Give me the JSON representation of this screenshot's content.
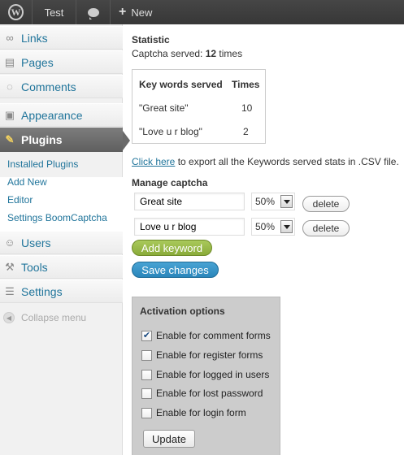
{
  "adminbar": {
    "logo_icon": "wordpress-logo-icon",
    "site_label": "Test",
    "comments_icon": "comment-bubble-icon",
    "new_label": "New"
  },
  "sidebar": {
    "items": [
      {
        "label": "Links",
        "icon": "link-icon"
      },
      {
        "label": "Pages",
        "icon": "pages-icon"
      },
      {
        "label": "Comments",
        "icon": "comments-icon"
      },
      {
        "label": "Appearance",
        "icon": "appearance-icon"
      },
      {
        "label": "Plugins",
        "icon": "plugin-icon"
      },
      {
        "label": "Users",
        "icon": "users-icon"
      },
      {
        "label": "Tools",
        "icon": "tools-icon"
      },
      {
        "label": "Settings",
        "icon": "settings-icon"
      }
    ],
    "submenu": [
      "Installed Plugins",
      "Add New",
      "Editor",
      "Settings BoomCaptcha"
    ],
    "collapse_label": "Collapse menu"
  },
  "main": {
    "statistic_heading": "Statistic",
    "served_prefix": "Captcha served: ",
    "served_count": "12",
    "served_suffix": " times",
    "table": {
      "headers": [
        "Key words served",
        "Times"
      ],
      "rows": [
        {
          "keyword": "\"Great site\"",
          "times": "10"
        },
        {
          "keyword": "\"Love u r blog\"",
          "times": "2"
        }
      ]
    },
    "export_link": "Click here",
    "export_text": " to export all the Keywords served stats in .CSV file.",
    "manage_heading": "Manage captcha",
    "keywords": [
      {
        "value": "Great site",
        "percent": "50%",
        "delete_label": "delete"
      },
      {
        "value": "Love u r blog",
        "percent": "50%",
        "delete_label": "delete"
      }
    ],
    "add_label": "Add keyword",
    "save_label": "Save changes",
    "activation": {
      "title": "Activation options",
      "options": [
        {
          "label": "Enable for comment forms",
          "checked": true
        },
        {
          "label": "Enable for register forms",
          "checked": false
        },
        {
          "label": "Enable for logged in users",
          "checked": false
        },
        {
          "label": "Enable for lost password",
          "checked": false
        },
        {
          "label": "Enable for login form",
          "checked": false
        }
      ],
      "update_label": "Update"
    }
  }
}
